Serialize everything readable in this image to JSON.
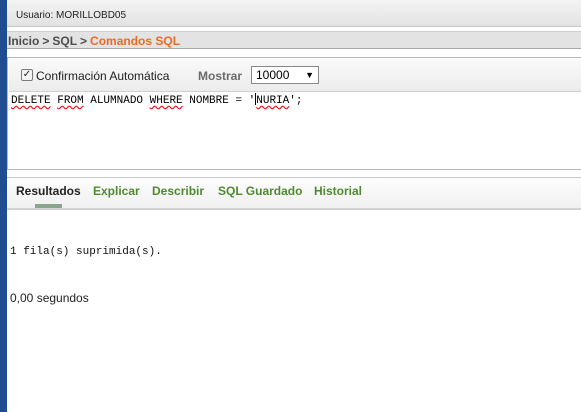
{
  "header": {
    "user_label": "Usuario: MORILLOBD05"
  },
  "breadcrumb": {
    "home": "Inicio",
    "sql": "SQL",
    "current": "Comandos SQL",
    "separator": ">"
  },
  "toolbar": {
    "autocommit_label": "Confirmación Automática",
    "autocommit_checked": true,
    "show_label": "Mostrar",
    "show_value": "10000"
  },
  "editor": {
    "sql_part1": "DELETE",
    "sql_part2": " ",
    "sql_part3": "FROM",
    "sql_part4": " ALUMNADO ",
    "sql_part5": "WHERE",
    "sql_part6": " NOMBRE = '",
    "sql_part7": "NURIA",
    "sql_part8": "';"
  },
  "tabs": [
    {
      "label": "Resultados"
    },
    {
      "label": "Explicar"
    },
    {
      "label": "Describir"
    },
    {
      "label": "SQL Guardado"
    },
    {
      "label": "Historial"
    }
  ],
  "results": {
    "message": "1 fila(s) suprimida(s).",
    "time": "0,00 segundos"
  },
  "colors": {
    "accent": "#e96b22",
    "tab_link": "#4f8a2f",
    "sidebar": "#1f4d8f"
  }
}
